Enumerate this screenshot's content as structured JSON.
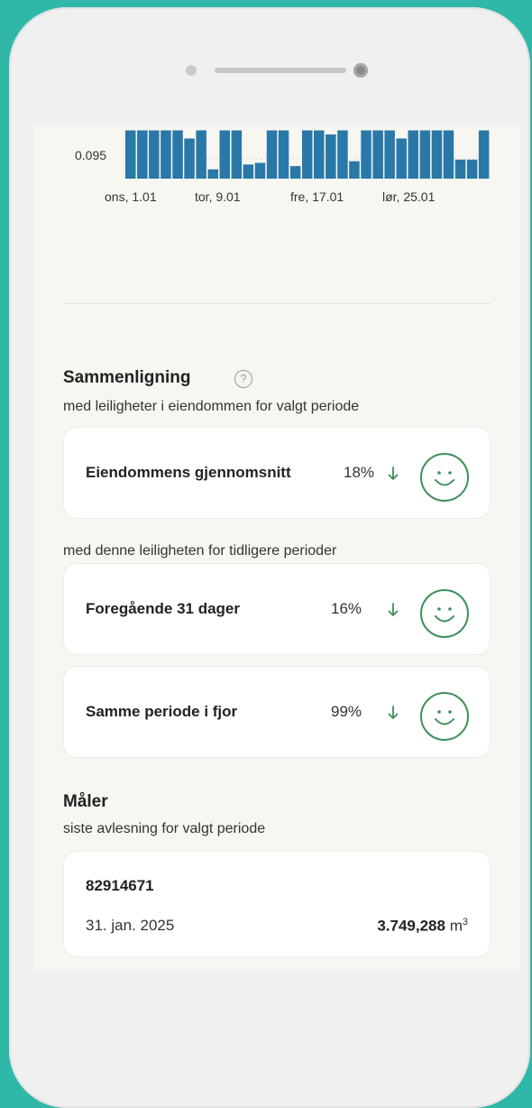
{
  "chart_data": {
    "type": "bar",
    "ytick_label": "0.095",
    "xtick_labels": [
      "ons, 1.01",
      "tor, 9.01",
      "fre, 17.01",
      "lør, 25.01"
    ],
    "values": [
      0.13,
      0.13,
      0.13,
      0.13,
      0.13,
      0.12,
      0.13,
      0.082,
      0.13,
      0.13,
      0.088,
      0.09,
      0.13,
      0.13,
      0.086,
      0.13,
      0.13,
      0.125,
      0.13,
      0.092,
      0.13,
      0.13,
      0.13,
      0.12,
      0.13,
      0.13,
      0.13,
      0.13,
      0.094,
      0.094,
      0.13
    ],
    "bar_color": "#2a78a8"
  },
  "comparison": {
    "title": "Sammenligning",
    "subtitle_property": "med leiligheter i eiendommen for valgt periode",
    "subtitle_history": "med denne leiligheten for tidligere perioder",
    "cards": [
      {
        "label": "Eiendommens gjennomsnitt",
        "percent": "18%",
        "trend": "down",
        "mood": "happy"
      },
      {
        "label": "Foregående 31 dager",
        "percent": "16%",
        "trend": "down",
        "mood": "happy"
      },
      {
        "label": "Samme periode i fjor",
        "percent": "99%",
        "trend": "down",
        "mood": "happy"
      }
    ],
    "accent_color": "#3e8f5a"
  },
  "meter": {
    "title": "Måler",
    "subtitle": "siste avlesning for valgt periode",
    "id": "82914671",
    "date": "31. jan. 2025",
    "value": "3.749,288",
    "unit": "m",
    "unit_sup": "3"
  },
  "icons": {
    "help": "?"
  }
}
